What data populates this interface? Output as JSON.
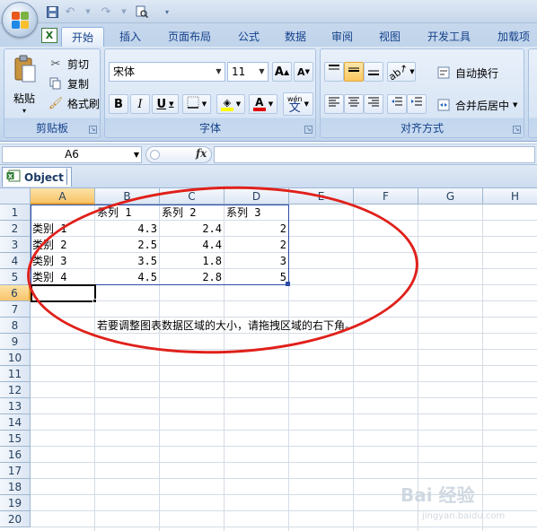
{
  "tabs": [
    {
      "label": "开始",
      "active": true
    },
    {
      "label": "插入"
    },
    {
      "label": "页面布局"
    },
    {
      "label": "公式"
    },
    {
      "label": "数据"
    },
    {
      "label": "审阅"
    },
    {
      "label": "视图"
    },
    {
      "label": "开发工具"
    },
    {
      "label": "加载项"
    }
  ],
  "clipboard": {
    "paste": "粘贴",
    "cut": "剪切",
    "copy": "复制",
    "format_painter": "格式刷",
    "group_label": "剪贴板"
  },
  "font": {
    "name": "宋体",
    "size": "11",
    "bold": "B",
    "italic": "I",
    "underline": "U",
    "group_label": "字体",
    "wen": "wén",
    "wen_char": "文",
    "grow": "A",
    "shrink": "A",
    "font_color_letter": "A"
  },
  "alignment": {
    "wrap": "自动换行",
    "merge": "合并后居中",
    "group_label": "对齐方式"
  },
  "formula_bar": {
    "name_box": "A6",
    "fx": "fx",
    "value": ""
  },
  "sheet": {
    "tab_name": "Object"
  },
  "columns": [
    "A",
    "B",
    "C",
    "D",
    "E",
    "F",
    "G",
    "H"
  ],
  "rows": [
    "1",
    "2",
    "3",
    "4",
    "5",
    "6",
    "7",
    "8",
    "9",
    "10",
    "11",
    "12",
    "13",
    "14",
    "15",
    "16",
    "17",
    "18",
    "19",
    "20"
  ],
  "cells": {
    "header": [
      "系列 1",
      "系列 2",
      "系列 3"
    ],
    "categories": [
      "类别 1",
      "类别 2",
      "类别 3",
      "类别 4"
    ],
    "values": [
      [
        "4.3",
        "2.4",
        "2"
      ],
      [
        "2.5",
        "4.4",
        "2"
      ],
      [
        "3.5",
        "1.8",
        "3"
      ],
      [
        "4.5",
        "2.8",
        "5"
      ]
    ],
    "note": "若要调整图表数据区域的大小，请拖拽区域的右下角。"
  },
  "watermark": {
    "main": "Bai 经验",
    "sub": "jingyan.baidu.com"
  },
  "colors": {
    "annotation_ellipse": "#e0201a",
    "selected_header": "#f8c46a",
    "range_border": "#2c4ca6"
  }
}
